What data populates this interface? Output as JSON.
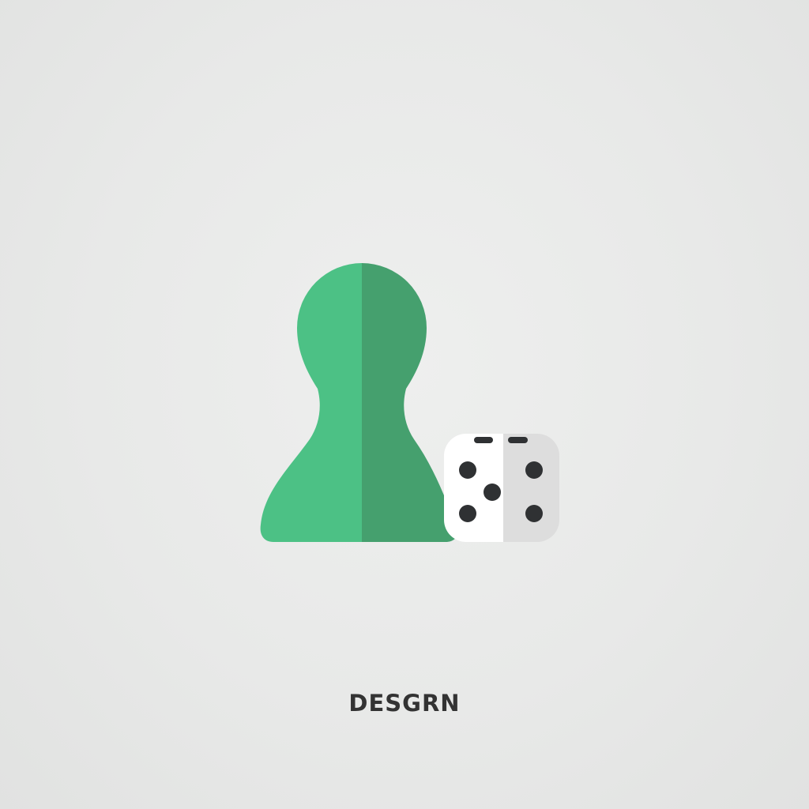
{
  "brand": {
    "name": "DESGRN"
  },
  "icons": {
    "pawn": "pawn-icon",
    "die": "die-icon"
  },
  "colors": {
    "background": "#e9eae9",
    "pawn_light": "#4cc185",
    "pawn_dark": "#45a06e",
    "die_light": "#ffffff",
    "die_shade": "#dddddd",
    "pips": "#2f3133",
    "text": "#333333"
  },
  "die": {
    "pips_shown": 5
  }
}
